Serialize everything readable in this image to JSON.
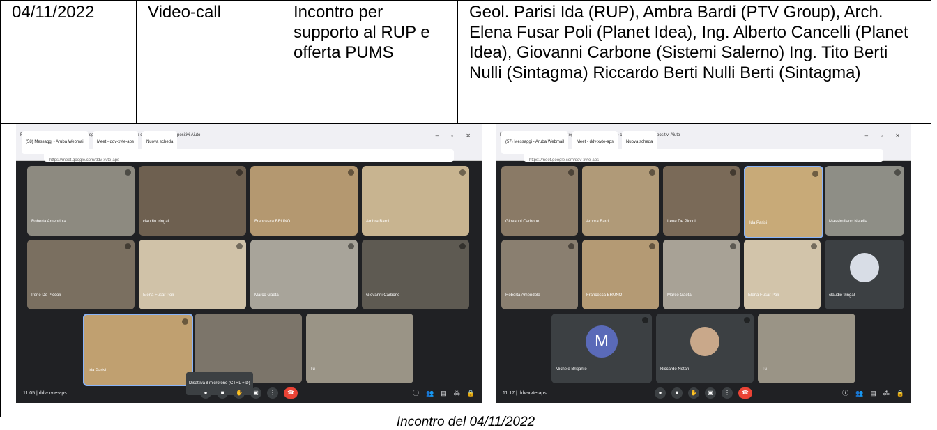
{
  "row": {
    "date": "04/11/2022",
    "mode": "Video-call",
    "subject": "Incontro per supporto al RUP e offerta PUMS",
    "participants": "Geol. Parisi Ida (RUP), Ambra Bardi (PTV Group), Arch. Elena Fusar Poli (Planet Idea), Ing. Alberto Cancelli (Planet Idea), Giovanni Carbone (Sistemi Salerno) Ing. Tito Berti Nulli (Sintagma) Riccardo Berti Nulli Berti (Sintagma)"
  },
  "caption": "Incontro del 04/11/2022",
  "shot1": {
    "menu": "File  Modifica  Visualizza  Cronologia  Segnalibri  Strumenti  Schede che condividono dispositivi  Aiuto",
    "tabs": [
      "(58) Messaggi - Aruba Webmail",
      "Meet - ddv-xvte-aps",
      "Nuova scheda"
    ],
    "url": "https://meet.google.com/ddv-xvte-aps",
    "names": [
      "Roberta Amendola",
      "claudio tringali",
      "Francesca BRUNO",
      "Ambra Bardi",
      "Irene De Piccoli",
      "Elena Fusar Poli",
      "Marco Gaeta",
      "Giovanni Carbone",
      "Ida Parisi",
      "",
      "Tu"
    ],
    "time": "11:05",
    "code": "ddv-xvte-aps",
    "tooltip": "Disattiva il microfono (CTRL + D)"
  },
  "shot2": {
    "menu": "File  Modifica  Visualizza  Cronologia  Segnalibri  Strumenti  Schede che condividono dispositivi  Aiuto",
    "tabs": [
      "(57) Messaggi - Aruba Webmail",
      "Meet - ddv-xvte-aps",
      "Nuova scheda"
    ],
    "url": "https://meet.google.com/ddv-xvte-aps",
    "names": [
      "Giovanni Carbone",
      "Ambra Bardi",
      "Irene De Piccoli",
      "Ida Parisi",
      "Massimiliano Natella",
      "Roberta Amendola",
      "Francesca BRUNO",
      "Marco Gaeta",
      "Elena Fusar Poli",
      "claudio tringali",
      "Michele Brigante",
      "Riccardo Notari",
      "Tu"
    ],
    "avatar_letter": "M",
    "time": "11:17",
    "code": "ddv-xvte-aps"
  }
}
